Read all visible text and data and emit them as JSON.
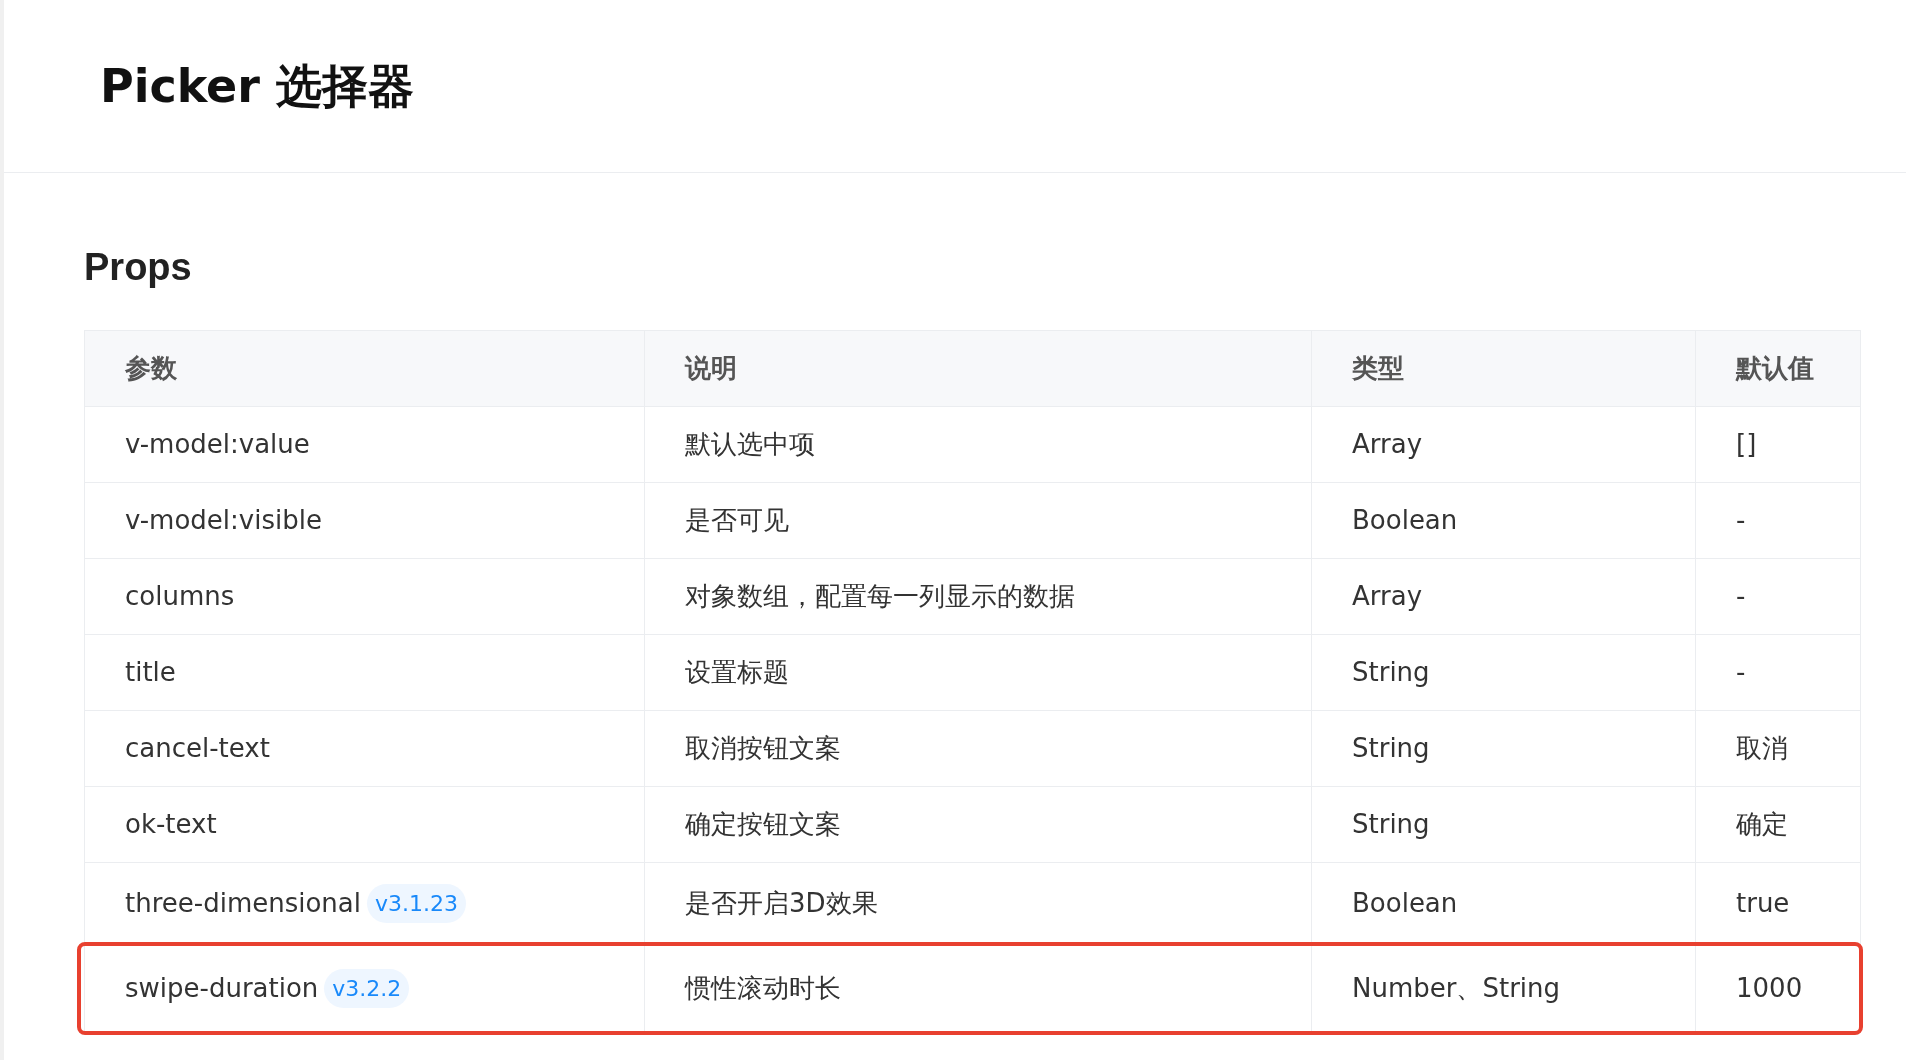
{
  "header": {
    "title": "Picker 选择器"
  },
  "section": {
    "title": "Props"
  },
  "table": {
    "columns": [
      "参数",
      "说明",
      "类型",
      "默认值"
    ],
    "rows": [
      {
        "name": "v-model:value",
        "desc": "默认选中项",
        "type": "Array",
        "default": "[]",
        "highlighted": false
      },
      {
        "name": "v-model:visible",
        "desc": "是否可见",
        "type": "Boolean",
        "default": "-",
        "highlighted": false
      },
      {
        "name": "columns",
        "desc": "对象数组，配置每一列显示的数据",
        "type": "Array",
        "default": "-",
        "highlighted": false
      },
      {
        "name": "title",
        "desc": "设置标题",
        "type": "String",
        "default": "-",
        "highlighted": false
      },
      {
        "name": "cancel-text",
        "desc": "取消按钮文案",
        "type": "String",
        "default": "取消",
        "highlighted": false
      },
      {
        "name": "ok-text",
        "desc": "确定按钮文案",
        "type": "String",
        "default": "确定",
        "highlighted": false
      },
      {
        "name": "three-dimensional",
        "version": "v3.1.23",
        "desc": "是否开启3D效果",
        "type": "Boolean",
        "default": "true",
        "highlighted": false
      },
      {
        "name": "swipe-duration",
        "version": "v3.2.2",
        "desc": "惯性滚动时长",
        "type": "Number、String",
        "default": "1000",
        "highlighted": true
      }
    ]
  }
}
